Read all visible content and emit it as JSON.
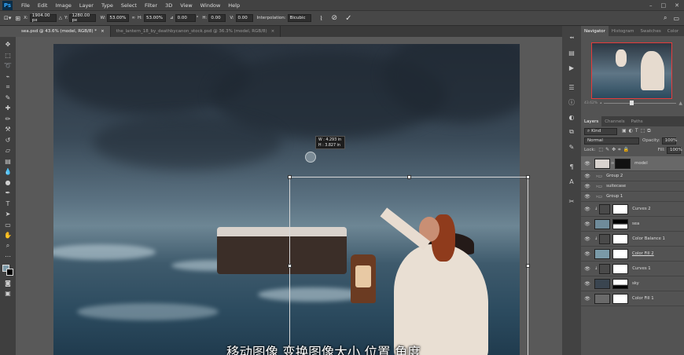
{
  "app": {
    "logo": "Ps"
  },
  "menu": [
    "File",
    "Edit",
    "Image",
    "Layer",
    "Type",
    "Select",
    "Filter",
    "3D",
    "View",
    "Window",
    "Help"
  ],
  "window_controls": [
    "–",
    "□",
    "✕"
  ],
  "options": {
    "x_label": "X:",
    "x_value": "1904.00 px",
    "y_label": "Y:",
    "y_value": "1280.00 px",
    "w_label": "W:",
    "w_value": "53.00%",
    "h_label": "H:",
    "h_value": "53.00%",
    "angle_value": "0.00",
    "hskew_label": "H:",
    "hskew_value": "0.00",
    "vskew_label": "V:",
    "vskew_value": "0.00",
    "interp_label": "Interpolation:",
    "interp_value": "Bicubic"
  },
  "doc_tabs": [
    {
      "label": "sea.psd @ 43.6% (model, RGB/8) *",
      "close": "×"
    },
    {
      "label": "the_lantern_18_by_deathbycanon_stock.psd @ 36.3% (model, RGB/8)",
      "close": "×"
    }
  ],
  "transform_tooltip": {
    "w": "W :   4.293 in",
    "h": "H :   3.827 in"
  },
  "subtitle": "移动图像  变换图像大小  位置  角度",
  "navigator": {
    "tabs": [
      "Navigator",
      "Histogram",
      "Swatches",
      "Color"
    ],
    "zoom": "43.62%"
  },
  "layers_panel": {
    "tabs": [
      "Layers",
      "Channels",
      "Paths"
    ],
    "filter": "Kind",
    "blend_mode": "Normal",
    "opacity_label": "Opacity:",
    "opacity_value": "100%",
    "lock_label": "Lock:",
    "fill_label": "Fill:",
    "fill_value": "100%",
    "layers": [
      {
        "name": "model",
        "type": "image",
        "active": true
      },
      {
        "name": "Group 2",
        "type": "group"
      },
      {
        "name": "suitecase",
        "type": "group"
      },
      {
        "name": "Group 1",
        "type": "group"
      },
      {
        "name": "Curves 2",
        "type": "adjust"
      },
      {
        "name": "sea",
        "type": "image"
      },
      {
        "name": "Color Balance 1",
        "type": "adjust"
      },
      {
        "name": "Color Fill 2",
        "type": "fill"
      },
      {
        "name": "Curves 1",
        "type": "adjust"
      },
      {
        "name": "sky",
        "type": "image"
      },
      {
        "name": "Color Fill 1",
        "type": "fill"
      }
    ]
  },
  "colors": {
    "accent": "#31a8ff",
    "nav_border": "#e63b3b"
  }
}
